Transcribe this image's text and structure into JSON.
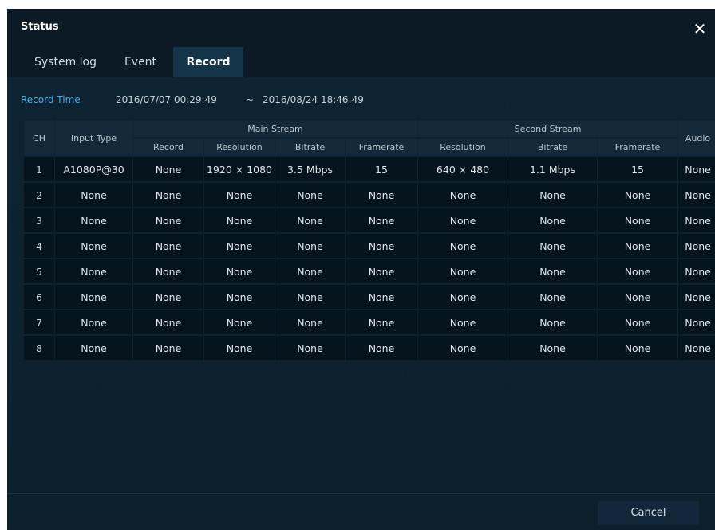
{
  "window": {
    "title": "Status",
    "close_glyph": "✕"
  },
  "tabs": [
    {
      "label": "System log",
      "active": false
    },
    {
      "label": "Event",
      "active": false
    },
    {
      "label": "Record",
      "active": true
    }
  ],
  "record_time": {
    "label": "Record Time",
    "start": "2016/07/07 00:29:49",
    "separator": "~",
    "end": "2016/08/24 18:46:49"
  },
  "table": {
    "headers": {
      "ch": "CH",
      "input_type": "Input Type",
      "main_stream": "Main Stream",
      "second_stream": "Second Stream",
      "audio": "Audio",
      "main_sub": [
        "Record",
        "Resolution",
        "Bitrate",
        "Framerate"
      ],
      "second_sub": [
        "Resolution",
        "Bitrate",
        "Framerate"
      ]
    },
    "rows": [
      [
        "1",
        "A1080P@30",
        "None",
        "1920 × 1080",
        "3.5 Mbps",
        "15",
        "640 × 480",
        "1.1 Mbps",
        "15",
        "None"
      ],
      [
        "2",
        "None",
        "None",
        "None",
        "None",
        "None",
        "None",
        "None",
        "None",
        "None"
      ],
      [
        "3",
        "None",
        "None",
        "None",
        "None",
        "None",
        "None",
        "None",
        "None",
        "None"
      ],
      [
        "4",
        "None",
        "None",
        "None",
        "None",
        "None",
        "None",
        "None",
        "None",
        "None"
      ],
      [
        "5",
        "None",
        "None",
        "None",
        "None",
        "None",
        "None",
        "None",
        "None",
        "None"
      ],
      [
        "6",
        "None",
        "None",
        "None",
        "None",
        "None",
        "None",
        "None",
        "None",
        "None"
      ],
      [
        "7",
        "None",
        "None",
        "None",
        "None",
        "None",
        "None",
        "None",
        "None",
        "None"
      ],
      [
        "8",
        "None",
        "None",
        "None",
        "None",
        "None",
        "None",
        "None",
        "None",
        "None"
      ]
    ]
  },
  "footer": {
    "cancel_label": "Cancel"
  },
  "colors": {
    "accent": "#4aa7e0",
    "background": "#0d2230",
    "cell": "#06141e",
    "header_cell": "#13293a"
  }
}
